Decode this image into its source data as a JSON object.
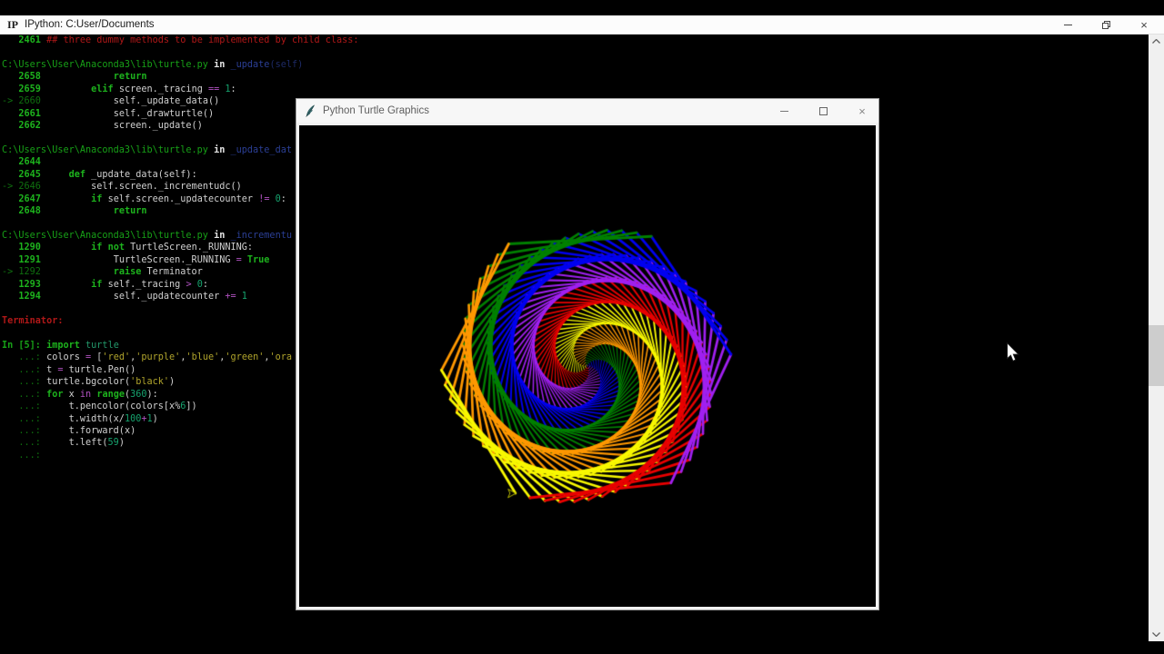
{
  "console": {
    "title_bar": {
      "app_icon": "IP",
      "title": "IPython: C:User/Documents",
      "controls": [
        {
          "name": "minimize"
        },
        {
          "name": "restore"
        },
        {
          "name": "close",
          "glyph": "×"
        }
      ]
    },
    "token_colors": {
      "t": "#d0d0d0",
      "ln": "#1db31d",
      "lnc": "#0f6f0f",
      "kw": "#1db31d",
      "op": "#b052c0",
      "num": "#16a36e",
      "str": "#b0a42c",
      "path": "#17a017",
      "hin": "#e6e6e6",
      "fn": "#2b3f96",
      "fna": "#1d2a66",
      "red": "#b01818",
      "err": "#b01818",
      "inp": "#17a017",
      "dots": "#0f6f0f",
      "mod": "#23996b"
    },
    "bold_tokens": [
      "ln",
      "kw",
      "hin",
      "err",
      "inp"
    ],
    "lines": [
      [
        [
          "   ",
          "t"
        ],
        [
          "2461",
          "ln"
        ],
        [
          " ",
          "t"
        ],
        [
          "## three dummy methods to be implemented by child class:",
          "red"
        ]
      ],
      [],
      [
        [
          "C:\\Users\\User\\Anaconda3\\lib\\turtle.py",
          "path"
        ],
        [
          " ",
          "t"
        ],
        [
          "in",
          "hin"
        ],
        [
          " ",
          "t"
        ],
        [
          "_update",
          "fn"
        ],
        [
          "(self)",
          "fna"
        ]
      ],
      [
        [
          "   ",
          "t"
        ],
        [
          "2658",
          "ln"
        ],
        [
          "             ",
          "t"
        ],
        [
          "return",
          "kw"
        ]
      ],
      [
        [
          "   ",
          "t"
        ],
        [
          "2659",
          "ln"
        ],
        [
          "         ",
          "t"
        ],
        [
          "elif",
          "kw"
        ],
        [
          " screen._tracing ",
          "t"
        ],
        [
          "==",
          "op"
        ],
        [
          " ",
          "t"
        ],
        [
          "1",
          "num"
        ],
        [
          ":",
          "t"
        ]
      ],
      [
        [
          "-> ",
          "lnc"
        ],
        [
          "2660",
          "lnc"
        ],
        [
          "             ",
          "t"
        ],
        [
          "self._update_data()",
          "t"
        ]
      ],
      [
        [
          "   ",
          "t"
        ],
        [
          "2661",
          "ln"
        ],
        [
          "             ",
          "t"
        ],
        [
          "self._drawturtle()",
          "t"
        ]
      ],
      [
        [
          "   ",
          "t"
        ],
        [
          "2662",
          "ln"
        ],
        [
          "             ",
          "t"
        ],
        [
          "screen._update()",
          "t"
        ]
      ],
      [],
      [
        [
          "C:\\Users\\User\\Anaconda3\\lib\\turtle.py",
          "path"
        ],
        [
          " ",
          "t"
        ],
        [
          "in",
          "hin"
        ],
        [
          " ",
          "t"
        ],
        [
          "_update_dat",
          "fn"
        ]
      ],
      [
        [
          "   ",
          "t"
        ],
        [
          "2644",
          "ln"
        ]
      ],
      [
        [
          "   ",
          "t"
        ],
        [
          "2645",
          "ln"
        ],
        [
          "     ",
          "t"
        ],
        [
          "def",
          "kw"
        ],
        [
          " _update_data(self):",
          "t"
        ]
      ],
      [
        [
          "-> ",
          "lnc"
        ],
        [
          "2646",
          "lnc"
        ],
        [
          "         ",
          "t"
        ],
        [
          "self.screen._incrementudc()",
          "t"
        ]
      ],
      [
        [
          "   ",
          "t"
        ],
        [
          "2647",
          "ln"
        ],
        [
          "         ",
          "t"
        ],
        [
          "if",
          "kw"
        ],
        [
          " self.screen._updatecounter ",
          "t"
        ],
        [
          "!=",
          "op"
        ],
        [
          " ",
          "t"
        ],
        [
          "0",
          "num"
        ],
        [
          ":",
          "t"
        ]
      ],
      [
        [
          "   ",
          "t"
        ],
        [
          "2648",
          "ln"
        ],
        [
          "             ",
          "t"
        ],
        [
          "return",
          "kw"
        ]
      ],
      [],
      [
        [
          "C:\\Users\\User\\Anaconda3\\lib\\turtle.py",
          "path"
        ],
        [
          " ",
          "t"
        ],
        [
          "in",
          "hin"
        ],
        [
          " ",
          "t"
        ],
        [
          "_incrementu",
          "fn"
        ]
      ],
      [
        [
          "   ",
          "t"
        ],
        [
          "1290",
          "ln"
        ],
        [
          "         ",
          "t"
        ],
        [
          "if",
          "kw"
        ],
        [
          " ",
          "t"
        ],
        [
          "not",
          "kw"
        ],
        [
          " TurtleScreen._RUNNING:",
          "t"
        ]
      ],
      [
        [
          "   ",
          "t"
        ],
        [
          "1291",
          "ln"
        ],
        [
          "             ",
          "t"
        ],
        [
          "TurtleScreen._RUNNING ",
          "t"
        ],
        [
          "=",
          "op"
        ],
        [
          " ",
          "t"
        ],
        [
          "True",
          "kw"
        ]
      ],
      [
        [
          "-> ",
          "lnc"
        ],
        [
          "1292",
          "lnc"
        ],
        [
          "             ",
          "t"
        ],
        [
          "raise",
          "kw"
        ],
        [
          " Terminator",
          "t"
        ]
      ],
      [
        [
          "   ",
          "t"
        ],
        [
          "1293",
          "ln"
        ],
        [
          "         ",
          "t"
        ],
        [
          "if",
          "kw"
        ],
        [
          " self._tracing ",
          "t"
        ],
        [
          ">",
          "op"
        ],
        [
          " ",
          "t"
        ],
        [
          "0",
          "num"
        ],
        [
          ":",
          "t"
        ]
      ],
      [
        [
          "   ",
          "t"
        ],
        [
          "1294",
          "ln"
        ],
        [
          "             ",
          "t"
        ],
        [
          "self._updatecounter ",
          "t"
        ],
        [
          "+=",
          "op"
        ],
        [
          " ",
          "t"
        ],
        [
          "1",
          "num"
        ]
      ],
      [],
      [
        [
          "Terminator",
          "err"
        ],
        [
          ": ",
          "err"
        ]
      ],
      [],
      [
        [
          "In [5]: ",
          "inp"
        ],
        [
          "import",
          "kw"
        ],
        [
          " ",
          "t"
        ],
        [
          "turtle",
          "mod"
        ]
      ],
      [
        [
          "   ...: ",
          "dots"
        ],
        [
          "colors ",
          "t"
        ],
        [
          "=",
          "op"
        ],
        [
          " [",
          "t"
        ],
        [
          "'red'",
          "str"
        ],
        [
          ",",
          "t"
        ],
        [
          "'purple'",
          "str"
        ],
        [
          ",",
          "t"
        ],
        [
          "'blue'",
          "str"
        ],
        [
          ",",
          "t"
        ],
        [
          "'green'",
          "str"
        ],
        [
          ",",
          "t"
        ],
        [
          "'ora",
          "str"
        ]
      ],
      [
        [
          "   ...: ",
          "dots"
        ],
        [
          "t ",
          "t"
        ],
        [
          "=",
          "op"
        ],
        [
          " turtle.Pen()",
          "t"
        ]
      ],
      [
        [
          "   ...: ",
          "dots"
        ],
        [
          "turtle.bgcolor(",
          "t"
        ],
        [
          "'black'",
          "str"
        ],
        [
          ")",
          "t"
        ]
      ],
      [
        [
          "   ...: ",
          "dots"
        ],
        [
          "for",
          "kw"
        ],
        [
          " x ",
          "t"
        ],
        [
          "in",
          "op"
        ],
        [
          " ",
          "t"
        ],
        [
          "range",
          "kw"
        ],
        [
          "(",
          "t"
        ],
        [
          "360",
          "num"
        ],
        [
          "):",
          "t"
        ]
      ],
      [
        [
          "   ...: ",
          "dots"
        ],
        [
          "    t.pencolor(colors[x%",
          "t"
        ],
        [
          "6",
          "num"
        ],
        [
          "])",
          "t"
        ]
      ],
      [
        [
          "   ...: ",
          "dots"
        ],
        [
          "    t.width(x/",
          "t"
        ],
        [
          "100",
          "num"
        ],
        [
          "+",
          "op"
        ],
        [
          "1",
          "num"
        ],
        [
          ")",
          "t"
        ]
      ],
      [
        [
          "   ...: ",
          "dots"
        ],
        [
          "    t.forward(x)",
          "t"
        ]
      ],
      [
        [
          "   ...: ",
          "dots"
        ],
        [
          "    t.left(",
          "t"
        ],
        [
          "59",
          "num"
        ],
        [
          ")",
          "t"
        ]
      ],
      [
        [
          "   ...:",
          "dots"
        ]
      ]
    ],
    "scrollbar": {
      "arrow_color": "#606060",
      "track_color": "#f0f0f0",
      "thumb_color": "#cdcdcd"
    }
  },
  "turtle_window": {
    "title": "Python Turtle Graphics",
    "controls": [
      {
        "name": "minimize"
      },
      {
        "name": "maximize"
      },
      {
        "name": "close",
        "glyph": "×"
      }
    ],
    "program": {
      "background": "black",
      "iterations": 360,
      "turn_left_deg": 59,
      "width_divisor": 100,
      "colors": [
        "red",
        "purple",
        "blue",
        "green",
        "orange",
        "yellow"
      ],
      "palette": {
        "red": "#e80000",
        "purple": "#a020f0",
        "blue": "#0000f0",
        "green": "#008000",
        "orange": "#ff9800",
        "yellow": "#f8f800"
      },
      "cursor_stroke": "#b8b800",
      "cursor_fill": "#000000"
    }
  }
}
